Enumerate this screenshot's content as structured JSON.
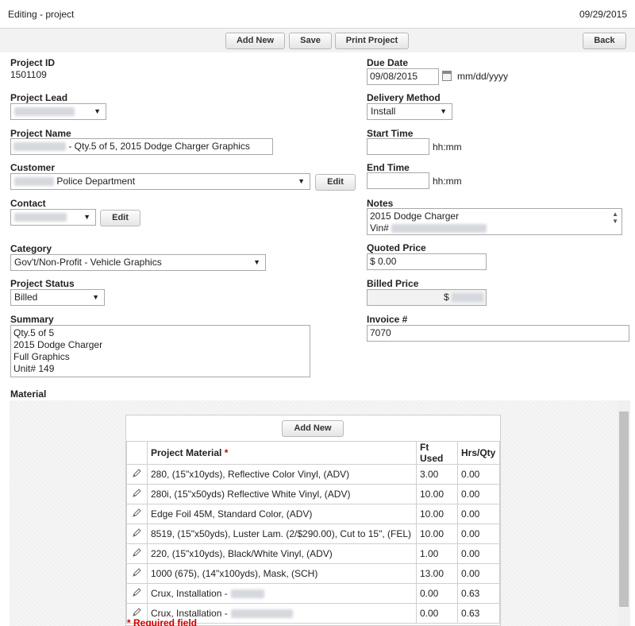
{
  "header": {
    "title": "Editing - project",
    "date": "09/29/2015"
  },
  "toolbar": {
    "add_new": "Add New",
    "save": "Save",
    "print_project": "Print Project",
    "back": "Back"
  },
  "left": {
    "project_id": {
      "label": "Project ID",
      "value": "1501109"
    },
    "project_lead": {
      "label": "Project Lead"
    },
    "project_name": {
      "label": "Project Name",
      "value": "- Qty.5 of 5, 2015 Dodge Charger Graphics"
    },
    "customer": {
      "label": "Customer",
      "value": "Police Department",
      "edit": "Edit"
    },
    "contact": {
      "label": "Contact",
      "edit": "Edit"
    },
    "category": {
      "label": "Category",
      "value": "Gov't/Non-Profit - Vehicle Graphics"
    },
    "project_status": {
      "label": "Project Status",
      "value": "Billed"
    },
    "summary": {
      "label": "Summary",
      "line1": "Qty.5 of 5",
      "line2": "2015 Dodge Charger",
      "line3": "Full Graphics",
      "line4": "Unit# 149"
    }
  },
  "right": {
    "due_date": {
      "label": "Due Date",
      "value": "09/08/2015",
      "format": "mm/dd/yyyy"
    },
    "delivery_method": {
      "label": "Delivery Method",
      "value": "Install"
    },
    "start_time": {
      "label": "Start Time",
      "format": "hh:mm"
    },
    "end_time": {
      "label": "End Time",
      "format": "hh:mm"
    },
    "notes": {
      "label": "Notes",
      "line1": "2015 Dodge Charger",
      "line2": "Vin#"
    },
    "quoted_price": {
      "label": "Quoted Price",
      "value": "$ 0.00"
    },
    "billed_price": {
      "label": "Billed Price",
      "currency": "$"
    },
    "invoice": {
      "label": "Invoice #",
      "value": "7070"
    }
  },
  "material": {
    "label": "Material",
    "add_new": "Add New",
    "columns": {
      "material": "Project Material",
      "required_mark": "*",
      "ft_used": "Ft Used",
      "hrs_qty": "Hrs/Qty"
    },
    "rows": [
      {
        "material": "280, (15\"x10yds), Reflective Color Vinyl, (ADV)",
        "ft": "3.00",
        "hrs": "0.00"
      },
      {
        "material": "280i, (15\"x50yds) Reflective White Vinyl, (ADV)",
        "ft": "10.00",
        "hrs": "0.00"
      },
      {
        "material": "Edge Foil 45M, Standard Color, (ADV)",
        "ft": "10.00",
        "hrs": "0.00"
      },
      {
        "material": "8519, (15\"x50yds), Luster Lam. (2/$290.00), Cut to 15\", (FEL)",
        "ft": "10.00",
        "hrs": "0.00"
      },
      {
        "material": "220, (15\"x10yds), Black/White Vinyl, (ADV)",
        "ft": "1.00",
        "hrs": "0.00"
      },
      {
        "material": "1000 (675), (14\"x100yds), Mask, (SCH)",
        "ft": "13.00",
        "hrs": "0.00"
      },
      {
        "material": "Crux, Installation -",
        "ft": "0.00",
        "hrs": "0.63"
      },
      {
        "material": "Crux, Installation -",
        "ft": "0.00",
        "hrs": "0.63"
      }
    ],
    "required_note": "* Required field"
  },
  "icons": {
    "pencil": "pencil-icon",
    "calendar": "calendar-icon"
  }
}
